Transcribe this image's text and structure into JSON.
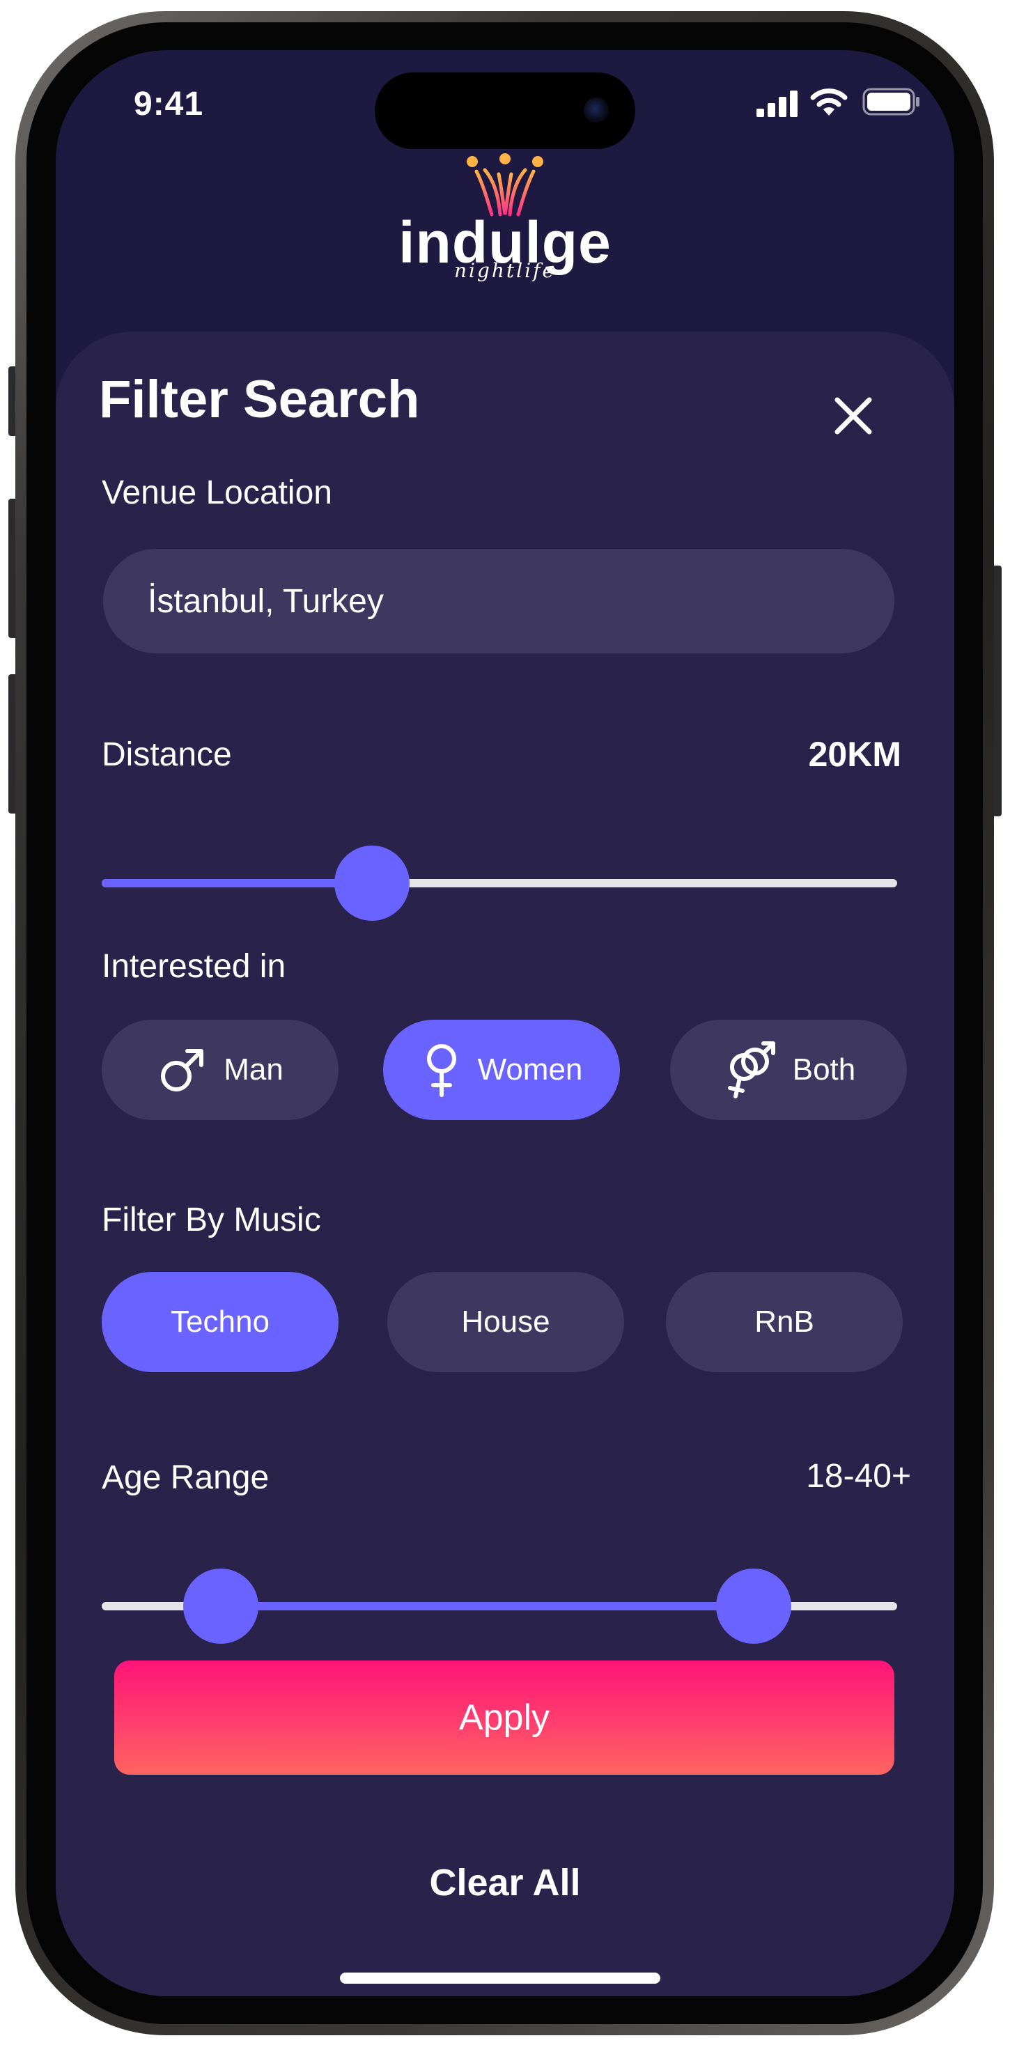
{
  "status_bar": {
    "time": "9:41"
  },
  "logo": {
    "word": "indulge",
    "tagline": "nightlife"
  },
  "filter": {
    "title": "Filter Search",
    "venue_location_label": "Venue Location",
    "venue_location_value": "İstanbul, Turkey",
    "distance_label": "Distance",
    "distance_value": "20KM",
    "distance_fraction": 0.34,
    "interested_label": "Interested in",
    "interested_options": [
      {
        "label": "Man",
        "icon": "male-icon",
        "selected": false
      },
      {
        "label": "Women",
        "icon": "female-icon",
        "selected": true
      },
      {
        "label": "Both",
        "icon": "both-genders-icon",
        "selected": false
      }
    ],
    "music_label": "Filter By Music",
    "music_options": [
      {
        "label": "Techno",
        "selected": true
      },
      {
        "label": "House",
        "selected": false
      },
      {
        "label": "RnB",
        "selected": false
      }
    ],
    "age_label": "Age Range",
    "age_value": "18-40+",
    "age_min_fraction": 0.15,
    "age_max_fraction": 0.82,
    "apply_label": "Apply",
    "clear_label": "Clear All"
  },
  "colors": {
    "background": "#1e1941",
    "sheet": "#29224a",
    "pill": "#3e3760",
    "accent": "#6b63ff",
    "apply_gradient_top": "#ff1478",
    "apply_gradient_bottom": "#ff6560"
  }
}
